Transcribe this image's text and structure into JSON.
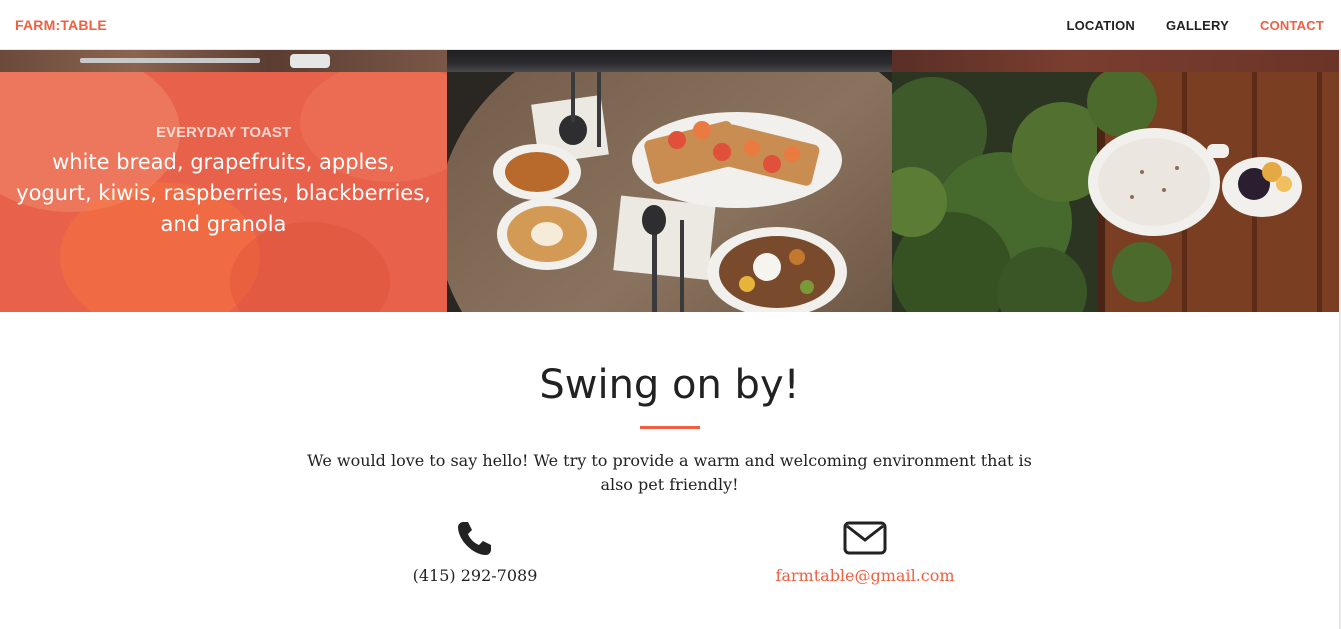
{
  "navbar": {
    "brand": "FARM:TABLE",
    "links": [
      {
        "label": "LOCATION",
        "active": false
      },
      {
        "label": "GALLERY",
        "active": false
      },
      {
        "label": "CONTACT",
        "active": true
      }
    ]
  },
  "gallery": {
    "tiles": [
      {
        "category": "EVERYDAY TOAST",
        "name": "white bread, grapefruits, apples, yogurt, kiwis, raspberries, blackberries, and granola"
      }
    ]
  },
  "contact": {
    "title": "Swing on by!",
    "text": "We would love to say hello! We try to provide a warm and welcoming environment that is also pet friendly!",
    "phone": "(415) 292-7089",
    "email": "farmtable@gmail.com"
  },
  "colors": {
    "accent": "#f05f40",
    "text": "#222222"
  },
  "icons": {
    "phone": "phone-icon",
    "email": "envelope-icon"
  }
}
